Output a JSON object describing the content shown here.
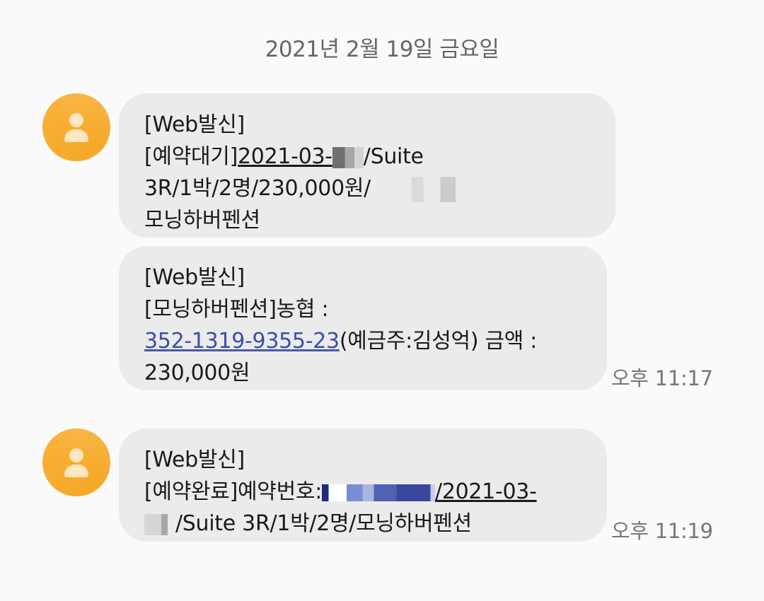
{
  "date_header": "2021년 2월 19일 금요일",
  "messages": [
    {
      "line1": "[Web발신]",
      "line2_prefix": "[예약대기]",
      "line2_date": "2021-03-",
      "line2_suffix": "/Suite",
      "line3": "3R/1박/2명/230,000원/",
      "line4": "모닝하버펜션"
    },
    {
      "line1": "[Web발신]",
      "line2": "[모닝하버펜션]농협 :",
      "account": "352-1319-9355-23",
      "line3_suffix": "(예금주:김성억) 금액 :",
      "line4": "230,000원",
      "time": "오후 11:17"
    },
    {
      "line1": "[Web발신]",
      "line2_prefix": "[예약완료]예약번호:",
      "line2_suffix": "/2021-03-",
      "line3": "/Suite 3R/1박/2명/모닝하버펜션",
      "time": "오후 11:19"
    }
  ],
  "icons": {
    "avatar": "person-icon",
    "avatar_color": "#f5a623"
  }
}
